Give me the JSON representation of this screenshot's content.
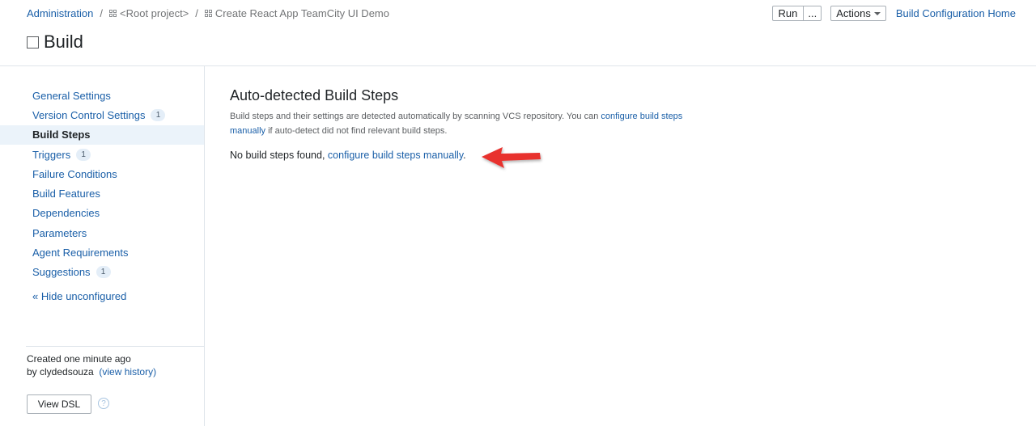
{
  "breadcrumb": {
    "admin": "Administration",
    "sep": "/",
    "root": "<Root project>",
    "project": "Create React App TeamCity UI Demo"
  },
  "page_title": "Build",
  "header_actions": {
    "run": "Run",
    "more": "...",
    "actions": "Actions",
    "home": "Build Configuration Home"
  },
  "sidebar": {
    "items": [
      {
        "label": "General Settings",
        "badge": ""
      },
      {
        "label": "Version Control Settings",
        "badge": "1"
      },
      {
        "label": "Build Steps",
        "badge": ""
      },
      {
        "label": "Triggers",
        "badge": "1"
      },
      {
        "label": "Failure Conditions",
        "badge": ""
      },
      {
        "label": "Build Features",
        "badge": ""
      },
      {
        "label": "Dependencies",
        "badge": ""
      },
      {
        "label": "Parameters",
        "badge": ""
      },
      {
        "label": "Agent Requirements",
        "badge": ""
      },
      {
        "label": "Suggestions",
        "badge": "1"
      }
    ],
    "hide_link": "« Hide unconfigured",
    "created": "Created one minute ago",
    "by": "by clydedsouza",
    "view_history": "(view history)",
    "view_dsl": "View DSL",
    "help": "?"
  },
  "main": {
    "heading": "Auto-detected Build Steps",
    "desc_before": "Build steps and their settings are detected automatically by scanning VCS repository. You can ",
    "desc_link": "configure build steps manually",
    "desc_after": " if auto-detect did not find relevant build steps.",
    "status_before": "No build steps found, ",
    "status_link": "configure build steps manually",
    "status_after": "."
  },
  "colors": {
    "link": "#1a5fa8",
    "active_bg": "#ebf3fa",
    "arrow": "#e8312f"
  }
}
